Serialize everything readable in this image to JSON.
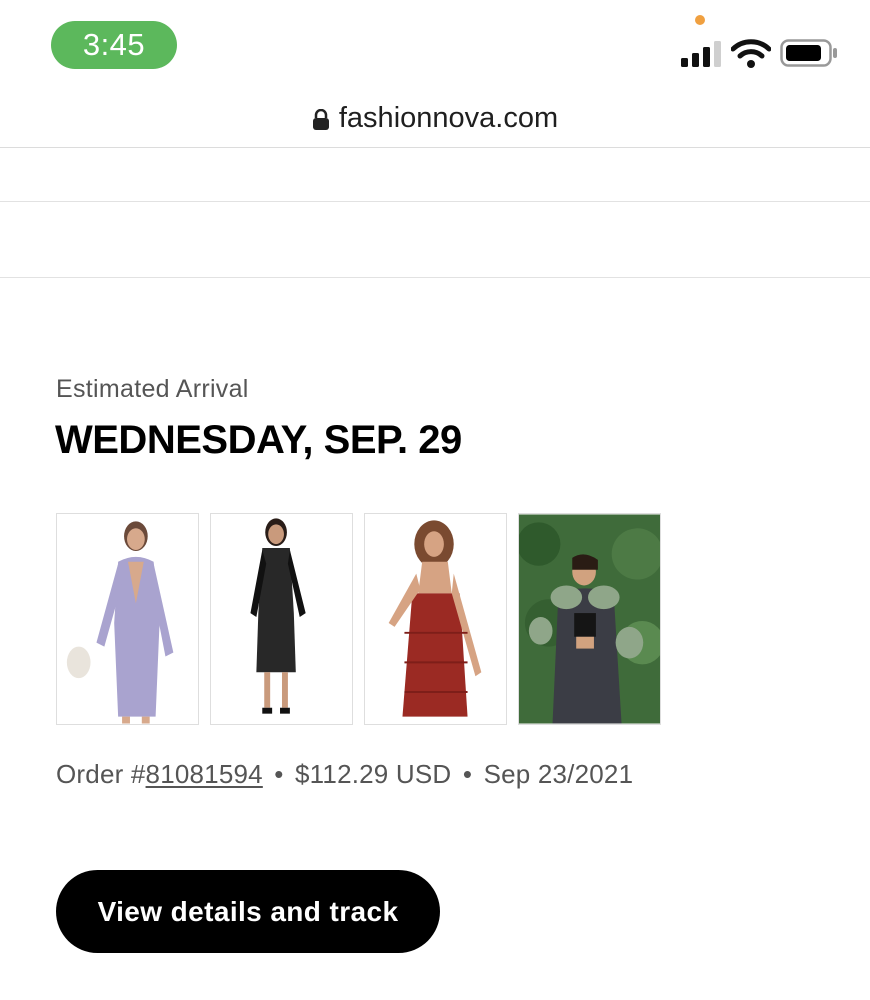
{
  "status_bar": {
    "time": "3:45",
    "time_pill_color": "#5cb85c",
    "icons": [
      "signal-icon",
      "wifi-icon",
      "battery-icon"
    ]
  },
  "browser": {
    "url": "fashionnova.com",
    "lock_icon": "lock-icon"
  },
  "delivery": {
    "eta_label": "Estimated Arrival",
    "eta_date": "WEDNESDAY, SEP. 29"
  },
  "products": [
    {
      "name": "lavender-bodycon-dress",
      "color": "#a9a3cf"
    },
    {
      "name": "black-sheer-dress",
      "color": "#111111"
    },
    {
      "name": "red-fringe-dress",
      "color": "#9b2a23"
    },
    {
      "name": "denim-jacket-fur-collar",
      "color": "#3b3d45"
    }
  ],
  "order": {
    "prefix": "Order #",
    "number": "81081594",
    "separator": "•",
    "total": "$112.29 USD",
    "date": "Sep 23/2021"
  },
  "actions": {
    "track_label": "View details and track"
  }
}
